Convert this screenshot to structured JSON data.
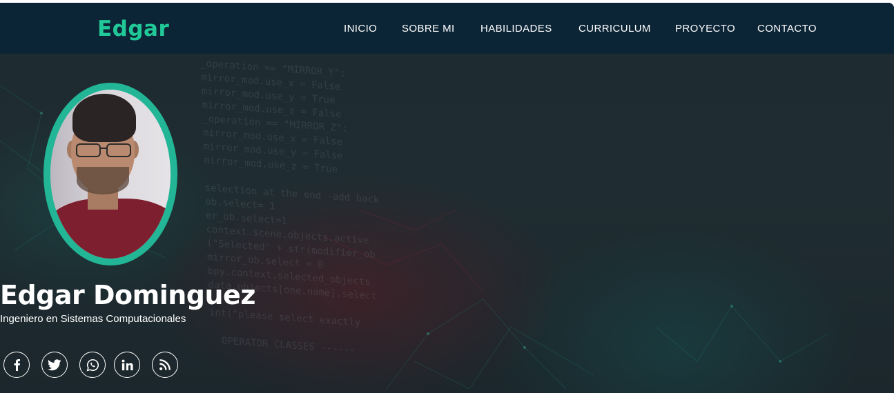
{
  "header": {
    "brand": "Edgar",
    "nav": [
      {
        "label": "INICIO",
        "name": "nav-inicio"
      },
      {
        "label": "SOBRE MI",
        "name": "nav-sobre-mi"
      },
      {
        "label": "HABILIDADES",
        "name": "nav-habilidades"
      },
      {
        "label": "CURRICULUM",
        "name": "nav-curriculum"
      },
      {
        "label": "PROYECTO",
        "name": "nav-proyecto"
      },
      {
        "label": "CONTACTO",
        "name": "nav-contacto"
      }
    ]
  },
  "hero": {
    "name": "Edgar Dominguez",
    "subtitle": "Ingeniero en Sistemas Computacionales",
    "background_code": [
      "_operation == \"MIRROR_Y\":",
      "mirror_mod.use_x = False",
      "mirror_mod.use_y = True",
      "mirror_mod.use_z = False",
      "_operation == \"MIRROR_Z\":",
      "mirror_mod.use_x = False",
      "mirror_mod.use_y = False",
      "mirror_mod.use_z = True",
      "",
      "selection at the end -add back",
      "ob.select= 1",
      "er_ob.select=1",
      "context.scene.objects.active",
      "(\"Selected\" + str(modifier_ob",
      "mirror_ob.select = 0",
      "bpy.context.selected_objects",
      "data.objects[one.name].select",
      "",
      "int(\"please select exactly",
      "",
      "  OPERATOR CLASSES ------"
    ],
    "social": [
      {
        "icon": "facebook-icon"
      },
      {
        "icon": "twitter-icon"
      },
      {
        "icon": "whatsapp-icon"
      },
      {
        "icon": "linkedin-icon"
      },
      {
        "icon": "rss-icon"
      }
    ]
  },
  "colors": {
    "navbar_bg": "#0c2536",
    "accent": "#20c997",
    "avatar_ring": "#22b596",
    "text": "#ffffff"
  }
}
